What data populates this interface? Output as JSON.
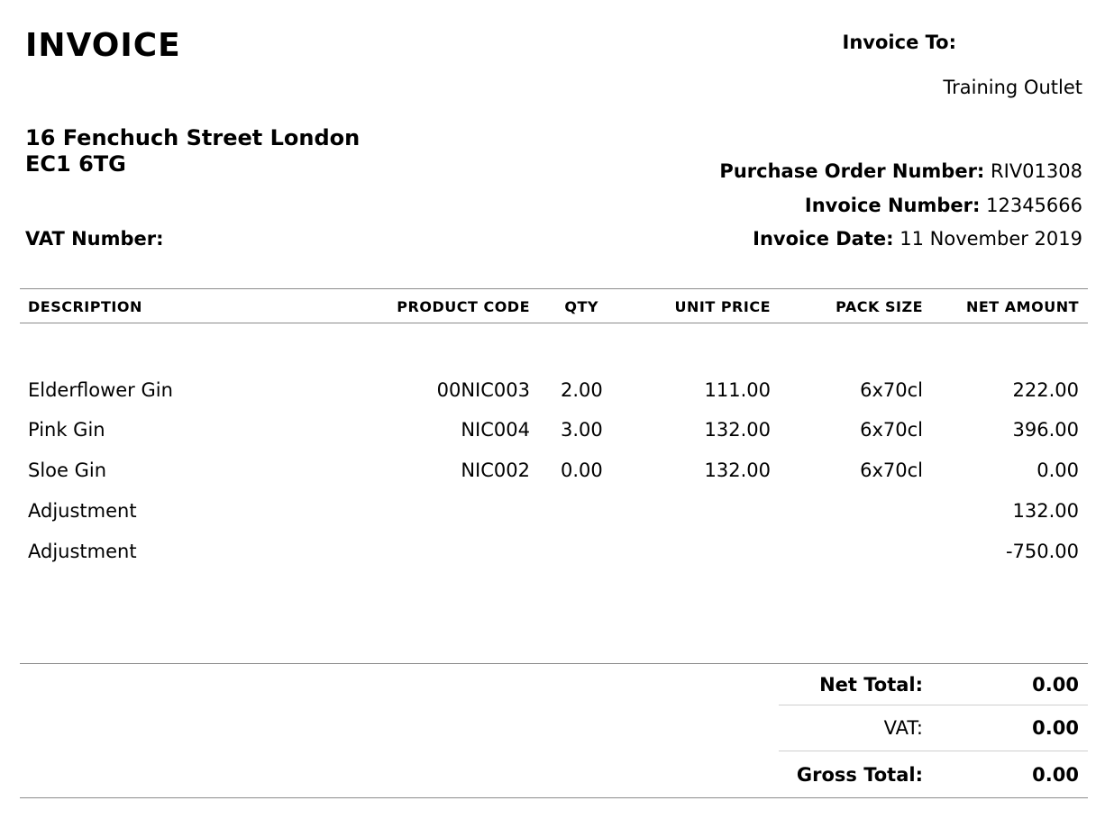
{
  "doc": {
    "title": "INVOICE",
    "address_line1": "16 Fenchuch Street London",
    "address_line2": "EC1 6TG",
    "vat_number_label": "VAT Number:"
  },
  "billing": {
    "invoice_to_label": "Invoice To:",
    "customer": "Training Outlet",
    "po_label": "Purchase Order Number:",
    "po_value": "RIV01308",
    "invoice_number_label": "Invoice Number:",
    "invoice_number_value": "12345666",
    "invoice_date_label": "Invoice Date:",
    "invoice_date_value": "11 November 2019"
  },
  "table": {
    "headers": {
      "description": "DESCRIPTION",
      "product_code": "PRODUCT CODE",
      "qty": "QTY",
      "unit_price": "UNIT PRICE",
      "pack_size": "PACK SIZE",
      "net_amount": "NET AMOUNT"
    },
    "rows": [
      {
        "description": "Elderflower Gin",
        "product_code": "00NIC003",
        "qty": "2.00",
        "unit_price": "111.00",
        "pack_size": "6x70cl",
        "net_amount": "222.00"
      },
      {
        "description": "Pink Gin",
        "product_code": "NIC004",
        "qty": "3.00",
        "unit_price": "132.00",
        "pack_size": "6x70cl",
        "net_amount": "396.00"
      },
      {
        "description": "Sloe Gin",
        "product_code": "NIC002",
        "qty": "0.00",
        "unit_price": "132.00",
        "pack_size": "6x70cl",
        "net_amount": "0.00"
      },
      {
        "description": "Adjustment",
        "product_code": "",
        "qty": "",
        "unit_price": "",
        "pack_size": "",
        "net_amount": "132.00"
      },
      {
        "description": "Adjustment",
        "product_code": "",
        "qty": "",
        "unit_price": "",
        "pack_size": "",
        "net_amount": "-750.00"
      }
    ]
  },
  "totals": {
    "net_total_label": "Net Total:",
    "net_total_value": "0.00",
    "vat_label": "VAT:",
    "vat_value": "0.00",
    "gross_total_label": "Gross Total:",
    "gross_total_value": "0.00"
  }
}
